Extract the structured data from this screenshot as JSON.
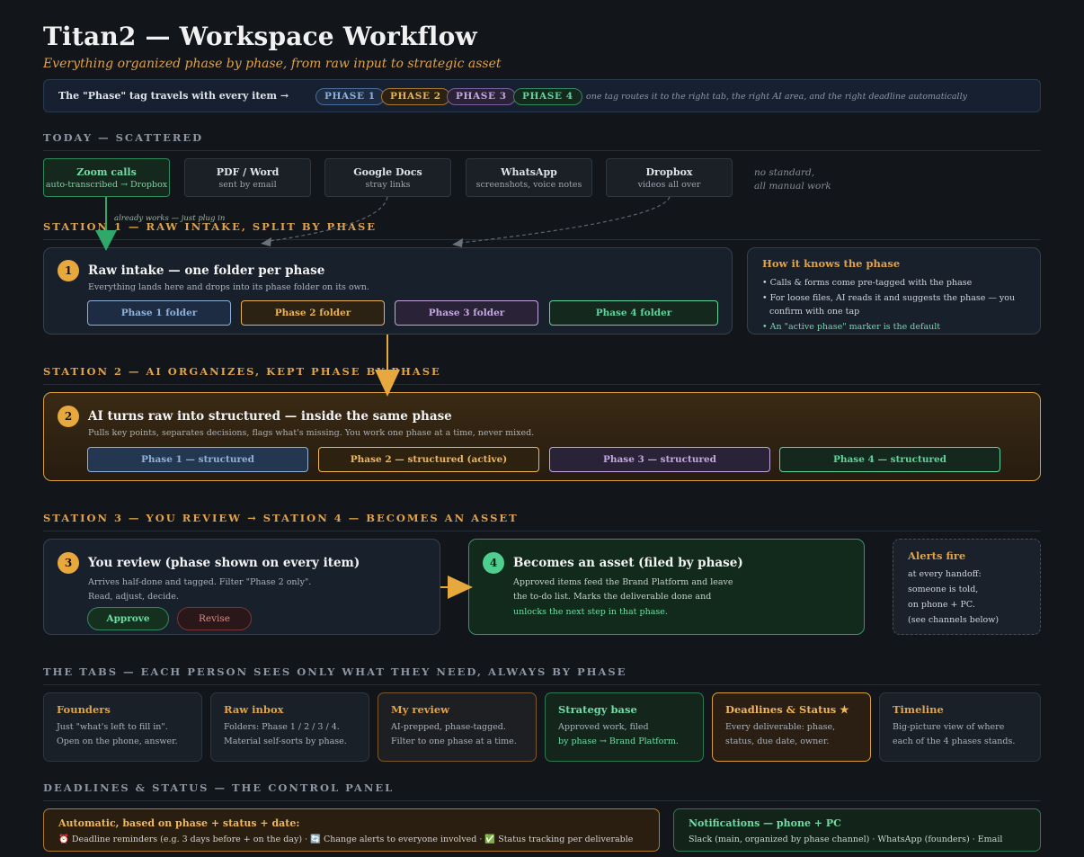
{
  "header": {
    "title": "Titan2 — Workspace Workflow",
    "subtitle": "Everything organized phase by phase, from raw input to strategic asset"
  },
  "tagbar": {
    "lead": "The \"Phase\" tag travels with every item →",
    "phases": [
      "PHASE 1",
      "PHASE 2",
      "PHASE 3",
      "PHASE 4"
    ],
    "note": "one tag routes it to the right tab, the right AI area, and the right deadline automatically"
  },
  "today": {
    "heading": "TODAY — SCATTERED",
    "sources": [
      {
        "title": "Zoom calls",
        "sub": "auto-transcribed → Dropbox"
      },
      {
        "title": "PDF / Word",
        "sub": "sent by email"
      },
      {
        "title": "Google Docs",
        "sub": "stray links"
      },
      {
        "title": "WhatsApp",
        "sub": "screenshots, voice notes"
      },
      {
        "title": "Dropbox",
        "sub": "videos all over"
      }
    ],
    "note_line1": "no standard,",
    "note_line2": "all manual work",
    "arrow_note": "already works — just plug in"
  },
  "station1": {
    "heading": "STATION 1 — RAW INTAKE, SPLIT BY PHASE",
    "num": "1",
    "title": "Raw intake — one folder per phase",
    "desc": "Everything lands here and drops into its phase folder on its own.",
    "folders": [
      "Phase 1 folder",
      "Phase 2 folder",
      "Phase 3 folder",
      "Phase 4 folder"
    ],
    "side": {
      "title": "How it knows the phase",
      "items": [
        "• Calls & forms come pre-tagged with the phase",
        "• For loose files, AI reads it and suggests the phase — you confirm with one tap",
        "• An \"active phase\" marker is the default"
      ]
    }
  },
  "station2": {
    "heading": "STATION 2 — AI ORGANIZES, KEPT PHASE BY PHASE",
    "num": "2",
    "title": "AI turns raw into structured — inside the same phase",
    "desc": "Pulls key points, separates decisions, flags what's missing. You work one phase at a time, never mixed.",
    "phases": [
      "Phase 1 — structured",
      "Phase 2 — structured (active)",
      "Phase 3 — structured",
      "Phase 4 — structured"
    ]
  },
  "station3": {
    "heading": "STATION 3 — YOU REVIEW → STATION 4 — BECOMES AN ASSET",
    "num": "3",
    "title": "You review (phase shown on every item)",
    "desc1": "Arrives half-done and tagged. Filter \"Phase 2 only\".",
    "desc2": "Read, adjust, decide.",
    "approve": "Approve",
    "revise": "Revise"
  },
  "station4": {
    "num": "4",
    "title": "Becomes an asset (filed by phase)",
    "desc1": "Approved items feed the Brand Platform and leave",
    "desc2": "the to-do list. Marks the deliverable done and",
    "desc3": "unlocks the next step in that phase."
  },
  "alerts": {
    "title": "Alerts fire",
    "l1": "at every handoff:",
    "l2": "someone is told,",
    "l3": "on phone + PC.",
    "l4": "(see channels below)"
  },
  "tabs": {
    "heading": "THE TABS — EACH PERSON SEES ONLY WHAT THEY NEED, ALWAYS BY PHASE",
    "items": [
      {
        "title": "Founders",
        "l1": "Just \"what's left to fill in\".",
        "l2": "Open on the phone, answer."
      },
      {
        "title": "Raw inbox",
        "l1": "Folders: Phase 1 / 2 / 3 / 4.",
        "l2": "Material self-sorts by phase."
      },
      {
        "title": "My review",
        "l1": "AI-prepped, phase-tagged.",
        "l2": "Filter to one phase at a time."
      },
      {
        "title": "Strategy base",
        "l1": "Approved work, filed",
        "l2": "by phase → Brand Platform."
      },
      {
        "title": "Deadlines & Status ★",
        "l1": "Every deliverable: phase,",
        "l2": "status, due date, owner."
      },
      {
        "title": "Timeline",
        "l1": "Big-picture view of where",
        "l2": "each of the 4 phases stands."
      }
    ]
  },
  "control": {
    "heading": "DEADLINES & STATUS — THE CONTROL PANEL",
    "auto_title": "Automatic, based on phase + status + date:",
    "auto_text": "⏰ Deadline reminders (e.g. 3 days before + on the day) · 🔄 Change alerts to everyone involved · ✅ Status tracking per deliverable",
    "notif_title": "Notifications — phone + PC",
    "notif_text": "Slack (main, organized by phase channel) · WhatsApp (founders) · Email"
  },
  "colors": {
    "phase1": "#8fb0d8",
    "phase2": "#e8b254",
    "phase3": "#c3a6e0",
    "phase4": "#5ed49a",
    "accent": "#e7a83e"
  }
}
